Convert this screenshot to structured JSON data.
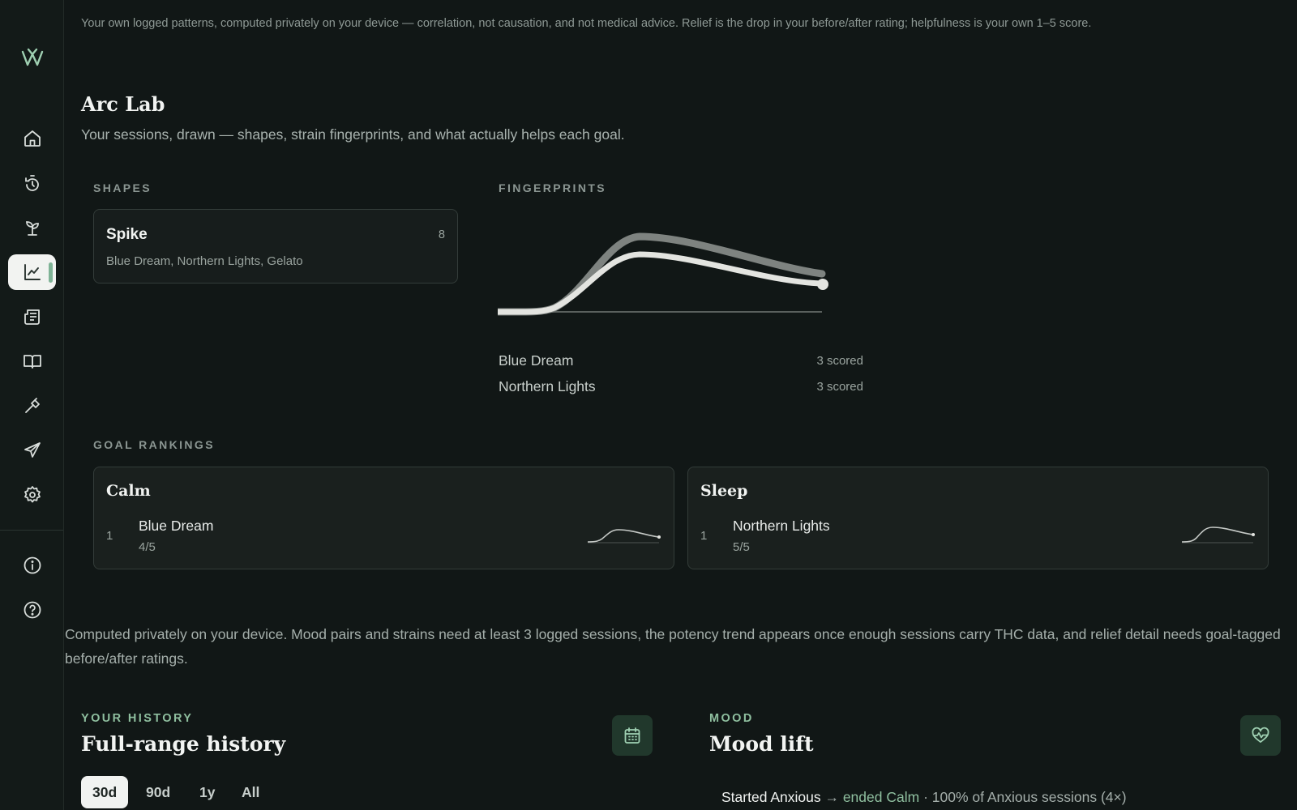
{
  "sidebar": {
    "logo": "w-logo",
    "items": [
      {
        "name": "home",
        "icon": "home-icon"
      },
      {
        "name": "timer",
        "icon": "timer-icon"
      },
      {
        "name": "growth",
        "icon": "sprout-icon"
      },
      {
        "name": "insights",
        "icon": "chart-icon",
        "active": true
      },
      {
        "name": "journal",
        "icon": "newspaper-icon"
      },
      {
        "name": "library",
        "icon": "book-icon"
      },
      {
        "name": "tools",
        "icon": "hammer-icon"
      },
      {
        "name": "travel",
        "icon": "plane-icon"
      },
      {
        "name": "settings",
        "icon": "gear-icon"
      },
      {
        "name": "about",
        "icon": "info-icon"
      },
      {
        "name": "help",
        "icon": "help-icon"
      }
    ]
  },
  "disclaimer": "Your own logged patterns, computed privately on your device — correlation, not causation, and not medical advice. Relief is the drop in your before/after rating; helpfulness is your own 1–5 score.",
  "arc_lab": {
    "title": "Arc Lab",
    "subtitle": "Your sessions, drawn — shapes, strain fingerprints, and what actually helps each goal.",
    "shapes_label": "SHAPES",
    "shape": {
      "name": "Spike",
      "count": "8",
      "strains": "Blue Dream, Northern Lights, Gelato"
    },
    "fingerprints_label": "FINGERPRINTS",
    "fingerprints": [
      {
        "name": "Blue Dream",
        "count": "3 scored",
        "color": "#e3e4e0"
      },
      {
        "name": "Northern Lights",
        "count": "3 scored",
        "color": "#8a8f8c"
      }
    ],
    "goal_rankings_label": "GOAL RANKINGS",
    "goals": [
      {
        "title": "Calm",
        "rank": "1",
        "strain": "Blue Dream",
        "score": "4/5"
      },
      {
        "title": "Sleep",
        "rank": "1",
        "strain": "Northern Lights",
        "score": "5/5"
      }
    ]
  },
  "computed_note": "Computed privately on your device. Mood pairs and strains need at least 3 logged sessions, the potency trend appears once enough sessions carry THC data, and relief detail needs goal-tagged before/after ratings.",
  "history": {
    "eyebrow": "YOUR HISTORY",
    "title": "Full-range history",
    "icon": "calendar-icon",
    "ranges": [
      "30d",
      "90d",
      "1y",
      "All"
    ],
    "selected_range": "30d"
  },
  "mood": {
    "eyebrow": "MOOD",
    "title": "Mood lift",
    "icon": "heart-pulse-icon",
    "started_label": "Started Anxious",
    "arrow": "→",
    "ended_label": "ended Calm",
    "detail": "· 100% of Anxious sessions (4×)"
  }
}
